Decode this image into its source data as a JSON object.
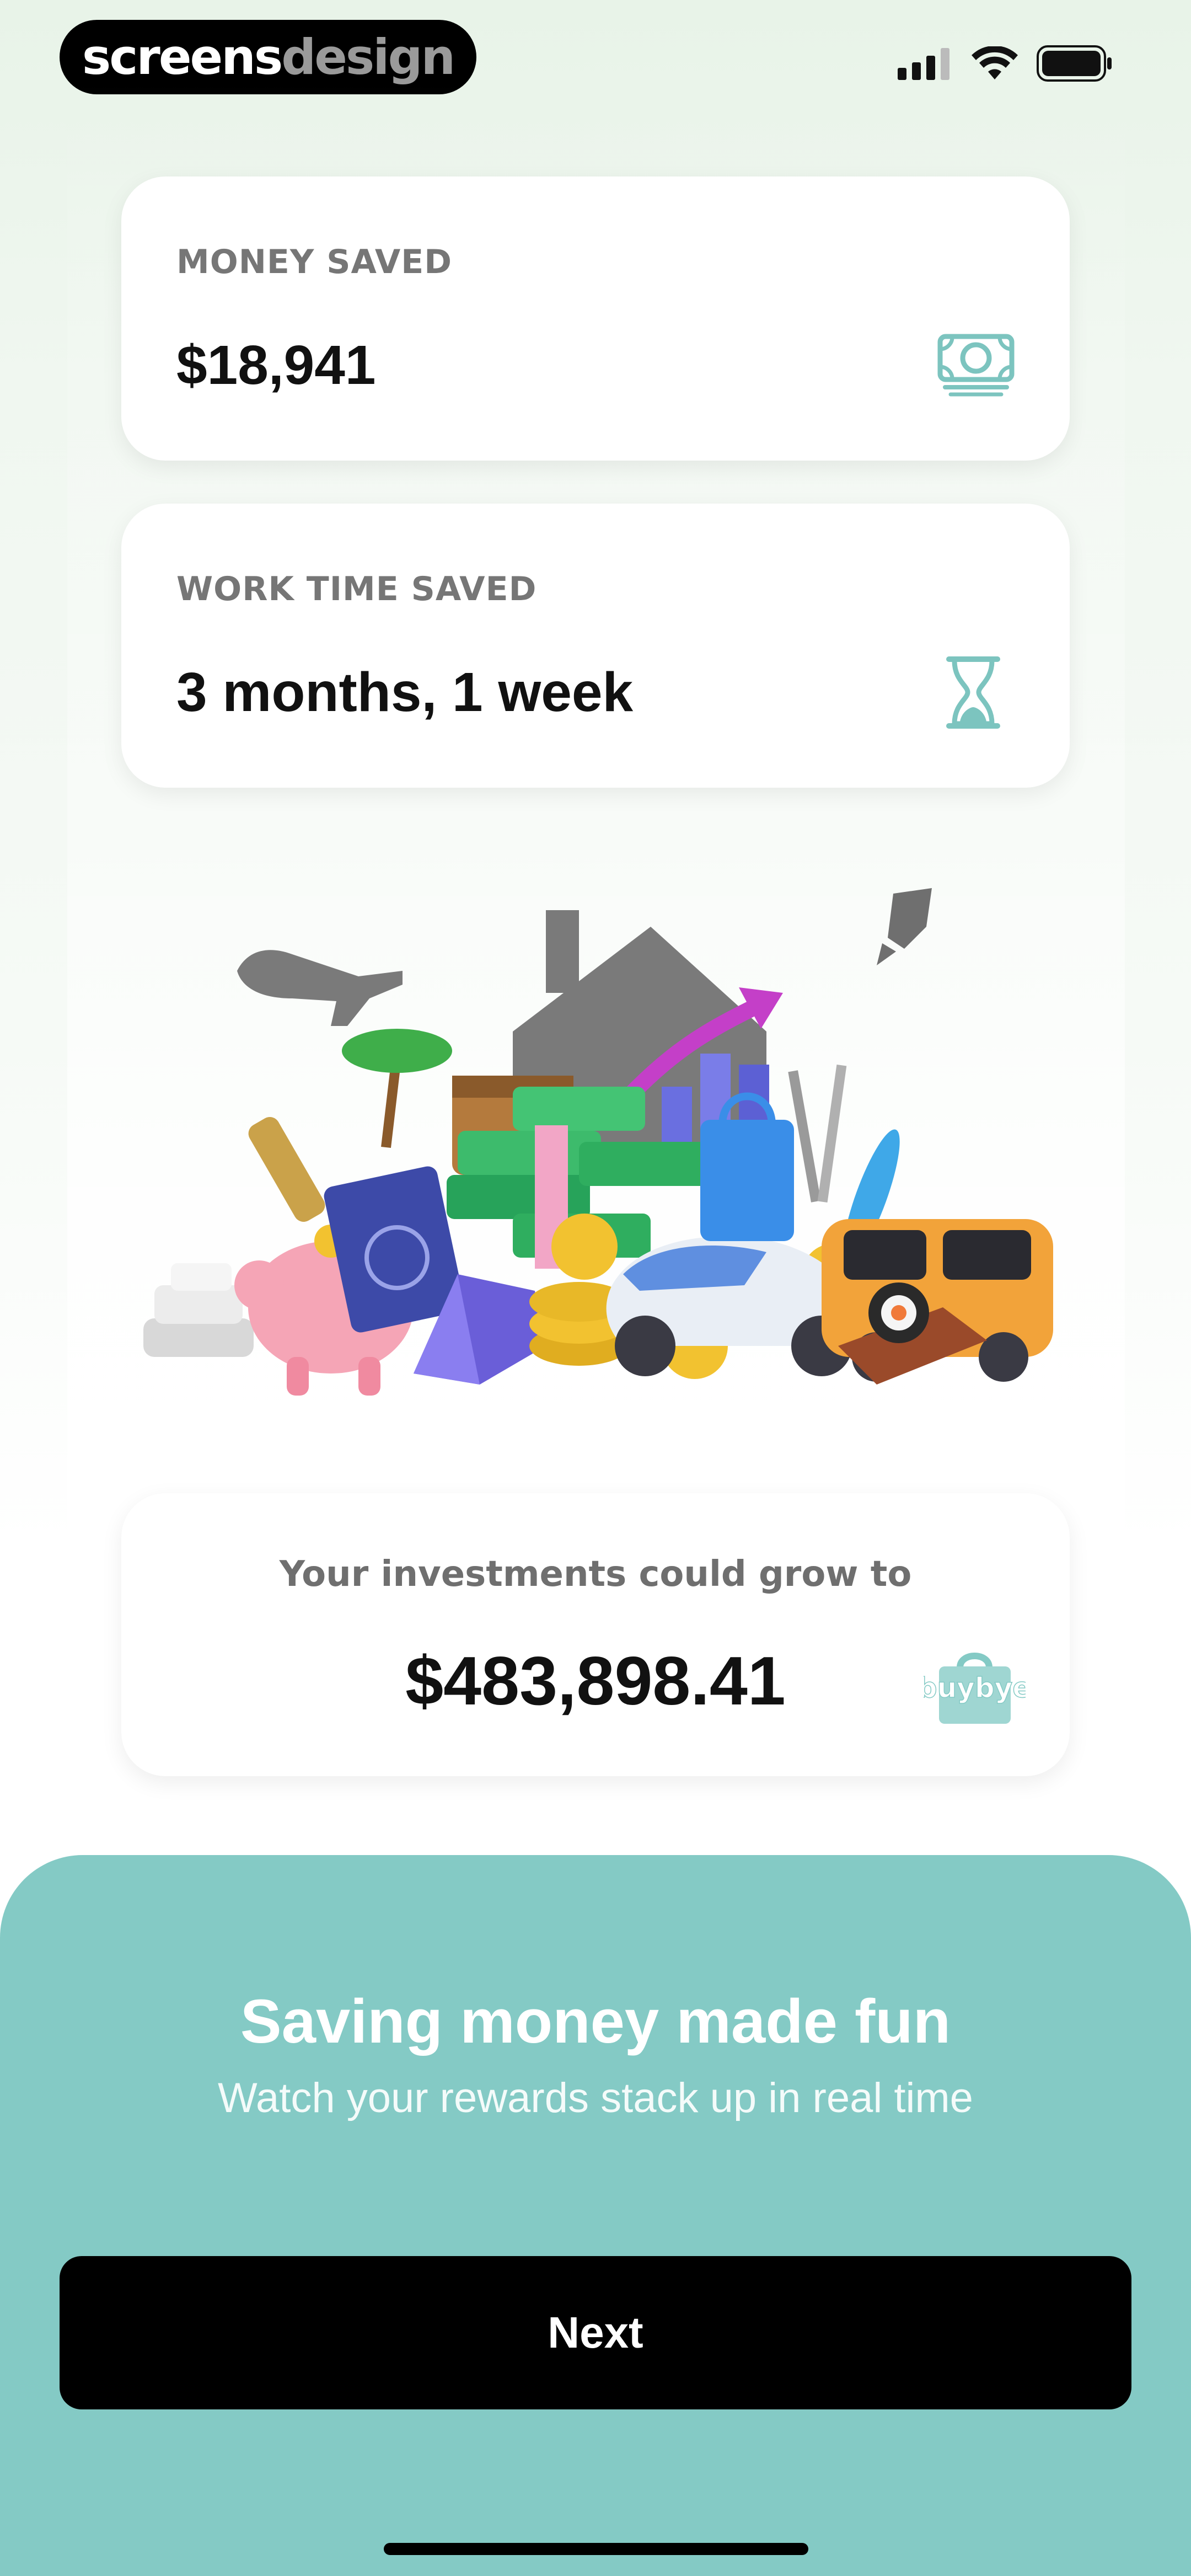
{
  "watermark": {
    "part1": "screens",
    "part2": "design"
  },
  "status_bar": {
    "signal_icon": "signal-bars-icon",
    "wifi_icon": "wifi-icon",
    "battery_icon": "battery-icon"
  },
  "cards": {
    "money_saved": {
      "label": "MONEY SAVED",
      "value": "$18,941",
      "icon": "banknote-icon"
    },
    "work_time_saved": {
      "label": "WORK TIME SAVED",
      "value": "3 months, 1 week",
      "icon": "hourglass-icon"
    }
  },
  "illustration": {
    "name": "rewards-illustration"
  },
  "investment_card": {
    "label": "Your investments could grow to",
    "value": "$483,898.41",
    "brand": "buybye"
  },
  "onboarding": {
    "title": "Saving money made fun",
    "subtitle": "Watch your rewards stack up in real time",
    "next_label": "Next"
  },
  "colors": {
    "accent": "#84cac5",
    "icon_teal": "#7cc4bf",
    "button": "#000000"
  }
}
